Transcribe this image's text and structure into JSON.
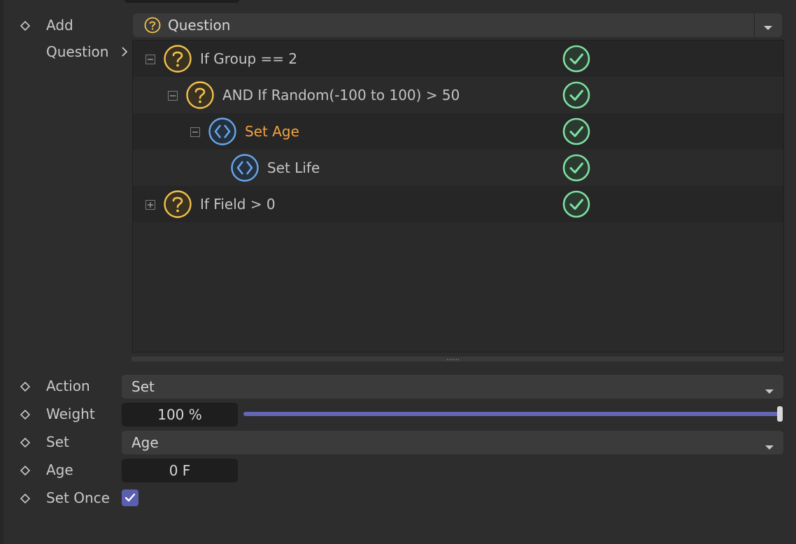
{
  "colors": {
    "background": "#2d2d2d",
    "question_icon": "#f2c14e",
    "action_icon": "#6aa6e8",
    "check_icon": "#7ee0a0",
    "active_label": "#f3a340",
    "slider_accent": "#6467b6"
  },
  "add": {
    "label": "Add",
    "selected_icon": "question-icon",
    "selected_value": "Question"
  },
  "question": {
    "label": "Question"
  },
  "tree": {
    "rows": [
      {
        "label": "If Group == 2",
        "icon": "question-icon",
        "expander": "collapse",
        "enabled": true,
        "active": false
      },
      {
        "label": "AND If Random(-100 to 100) > 50",
        "icon": "question-icon",
        "expander": "collapse",
        "enabled": true,
        "active": false
      },
      {
        "label": "Set Age",
        "icon": "action-icon",
        "expander": "collapse",
        "enabled": true,
        "active": true
      },
      {
        "label": "Set Life",
        "icon": "action-icon",
        "expander": "none",
        "enabled": true,
        "active": false
      },
      {
        "label": "If Field > 0",
        "icon": "question-icon",
        "expander": "expand",
        "enabled": true,
        "active": false
      }
    ]
  },
  "properties": {
    "action": {
      "label": "Action",
      "value": "Set"
    },
    "weight": {
      "label": "Weight",
      "value": "100 %",
      "fraction": 1.0
    },
    "set": {
      "label": "Set",
      "value": "Age"
    },
    "age": {
      "label": "Age",
      "value": "0 F"
    },
    "set_once": {
      "label": "Set Once",
      "checked": true
    }
  },
  "splitter": {
    "grip": "......"
  }
}
